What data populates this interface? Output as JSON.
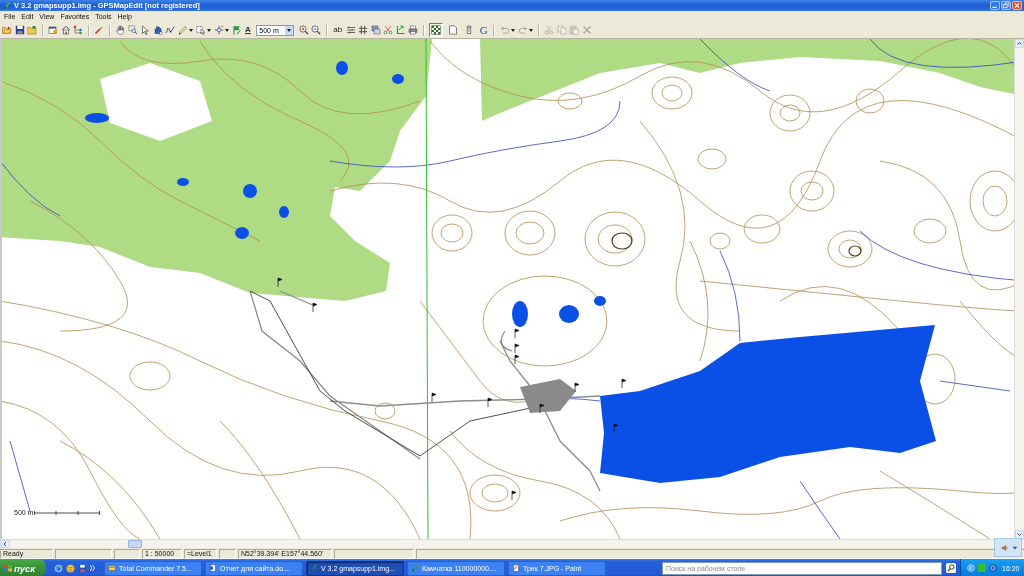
{
  "window": {
    "title": "V 3.2 gmapsupp1.img - GPSMapEdit [not registered]"
  },
  "menu": [
    "File",
    "Edit",
    "View",
    "Favorites",
    "Tools",
    "Help"
  ],
  "toolbar": {
    "text_tool": "A",
    "scale_field": {
      "value": "500 m"
    },
    "labels_button": "ab",
    "layer_toggles": [
      {
        "selected": true
      },
      {
        "selected": false
      },
      {
        "selected": false
      }
    ],
    "letter_button": "G",
    "undo_redo": {
      "disabled": true
    },
    "clipboard": {
      "disabled": true
    }
  },
  "map": {
    "scale_bar_label": "500 m"
  },
  "status_bar": {
    "message": "Ready",
    "scale": "1 : 50000",
    "zoom_level": "=Level1",
    "coordinates": "N52°39.394' E157°44.560'"
  },
  "taskbar": {
    "start": "пуск",
    "tasks": [
      {
        "label": "Total Commander 7.5...",
        "selected": false
      },
      {
        "label": "Отчет для сайта.do...",
        "selected": false
      },
      {
        "label": "V 3.2 gmapsupp1.img...",
        "selected": true
      },
      {
        "label": "Камчатка 110000000....",
        "selected": false
      },
      {
        "label": "Трек 7.JPG - Paint",
        "selected": false
      }
    ],
    "search": {
      "placeholder": "Поиск на рабочем столе"
    },
    "clock": "16:20"
  }
}
